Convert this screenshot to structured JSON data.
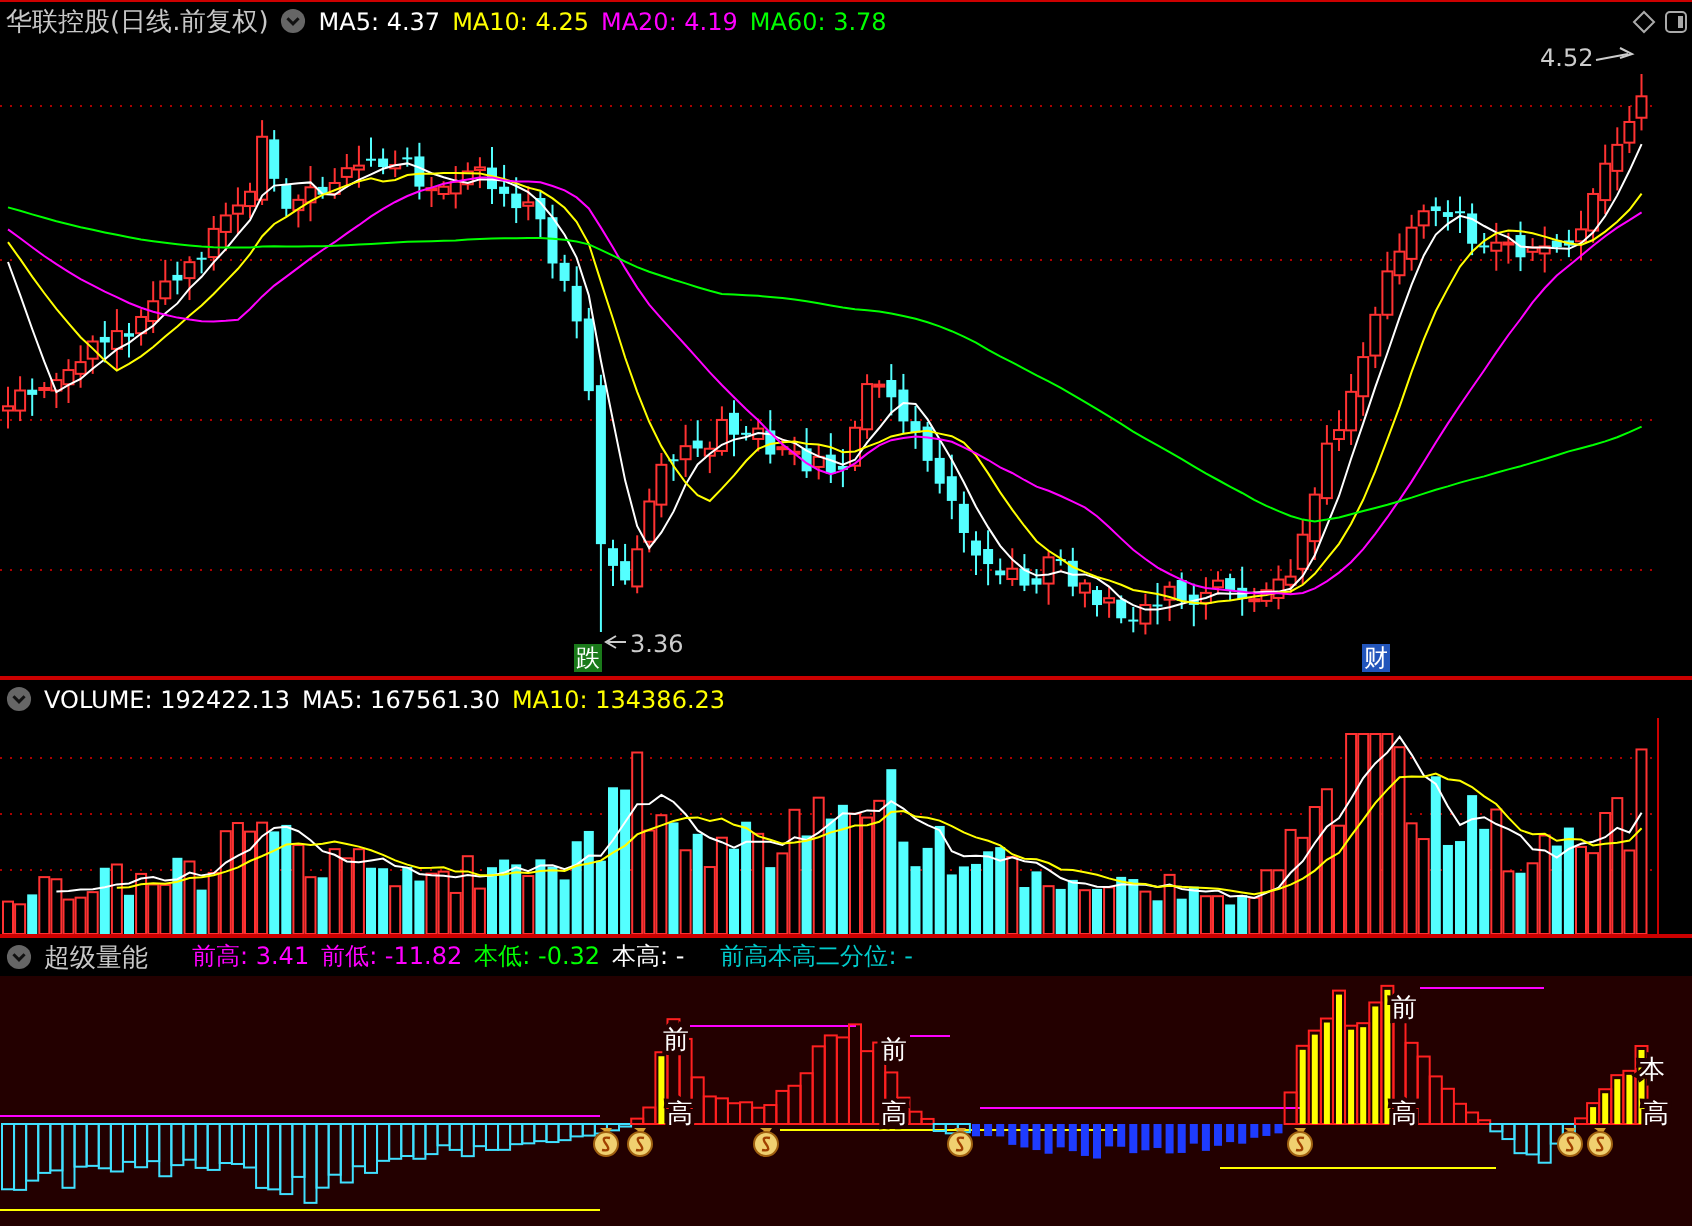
{
  "price_panel": {
    "title": "华联控股(日线.前复权)",
    "readings": [
      {
        "label": "MA5: 4.37",
        "color": "#ffffff"
      },
      {
        "label": "MA10: 4.25",
        "color": "#ffff00"
      },
      {
        "label": "MA20: 4.19",
        "color": "#ff00ff"
      },
      {
        "label": "MA60: 3.78",
        "color": "#00ff00"
      }
    ],
    "high_label": "4.52",
    "low_label": "3.36",
    "markers": [
      {
        "text": "跌",
        "kind": "down"
      },
      {
        "text": "财",
        "kind": "finance"
      }
    ]
  },
  "volume_panel": {
    "readings": [
      {
        "label": "VOLUME: 192422.13",
        "color": "#ffffff"
      },
      {
        "label": "MA5: 167561.30",
        "color": "#ffffff"
      },
      {
        "label": "MA10: 134386.23",
        "color": "#ffff00"
      }
    ]
  },
  "indicator_panel": {
    "title": "超级量能",
    "readings": [
      {
        "label": "前高: 3.41",
        "color": "#ff00ff"
      },
      {
        "label": "前低: -11.82",
        "color": "#ff00ff"
      },
      {
        "label": "本低: -0.32",
        "color": "#00ff00"
      },
      {
        "label": "本高: -",
        "color": "#ffffff"
      },
      {
        "label": "前高本高二分位: -",
        "color": "#00cccc"
      }
    ],
    "labels": [
      {
        "text": "前"
      },
      {
        "text": "高"
      },
      {
        "text": "前"
      },
      {
        "text": "高"
      },
      {
        "text": "前"
      },
      {
        "text": "高"
      },
      {
        "text": "本"
      },
      {
        "text": "高"
      }
    ]
  }
}
